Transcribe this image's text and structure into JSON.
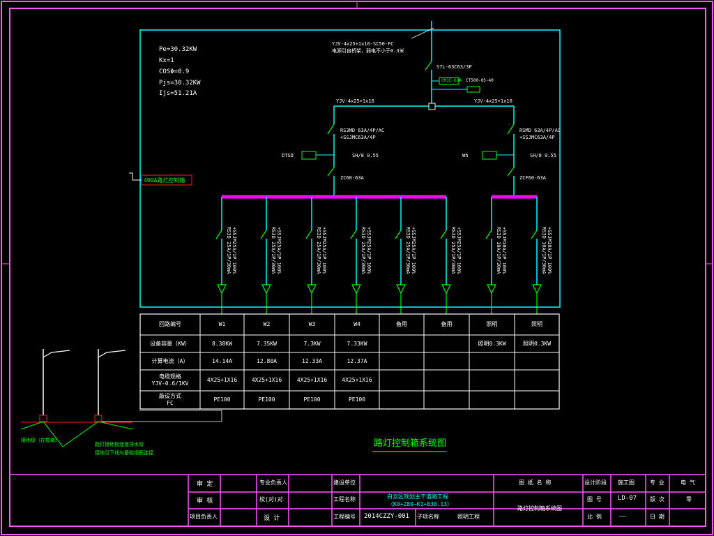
{
  "colors": {
    "frame": "#ff55ff",
    "wire": "#00ffff",
    "device": "#00ff00",
    "busbar": "#ff00ff",
    "table": "#ffffff",
    "red": "#ff2020",
    "title_green": "#00ff00"
  },
  "load_params": {
    "pe": "Pe=30.32KW",
    "kx": "Kx=1",
    "cos": "COSΦ=0.9",
    "pjs": "Pjs=30.32KW",
    "ijs": "Ijs=51.21A"
  },
  "incoming_cable": [
    "YJV-4x25+1x16-SC50-FC",
    "电源引自桥架，弱电不小于0.3米"
  ],
  "main_switch": "S7L-63C63/3P",
  "meter_left": "CM1E-63A",
  "meter_right": "CT500-05-40",
  "branch_cable_left": "YJV-4x25+1x16",
  "branch_cable_right": "YJV-4x25+1x16",
  "left_breaker": [
    "RS3MD 63A/4P/AC",
    "+SSJMC63A/4P"
  ],
  "right_breaker": [
    "RSMD 63A/4P/AC",
    "+SSJMC63A/4P"
  ],
  "left_controller": "DTSD",
  "right_controller": "Wh",
  "left_timer": "ZC60-63A",
  "right_timer": "ZCF60-63A",
  "left_value": "SH/8 0.55",
  "right_value": "SH/8 0.55",
  "red_label": "400A路灯控制箱",
  "feeder_labels": [
    [
      "RS3D 25A/1P/30mA",
      "+SSJM25A/1P 100%"
    ],
    [
      "RS3D 25A/1P/30mA",
      "+SSJM25A/1P 100%"
    ],
    [
      "RS3D 25A/1P/30mA",
      "+SSJM25A/1P 100%"
    ],
    [
      "RS3D 25A/1P/30mA",
      "+SSJM25A/1P 100%"
    ],
    [
      "RS3D 25A/1P/30mA",
      "+SSJM25A/1P 100%"
    ],
    [
      "RS3D 25A/1P/30mA",
      "+SSJM25A/1P 100%"
    ],
    [
      "RS3D 10A/1P/30mA",
      "+SSJM10A/1P 100%"
    ],
    [
      "RS3D 10A/1P/30mA",
      "+SSJM10A/1P 100%"
    ]
  ],
  "table": {
    "row_headers": [
      "回路编号",
      "设备容量（KW）",
      "计算电流（A）",
      "电缆规格\nYJV-0.6/1KV",
      "敲设方式\nFC"
    ],
    "columns": [
      [
        "W1",
        "8.38KW",
        "14.14A",
        "4X25+1X16",
        "PE100"
      ],
      [
        "W2",
        "7.35KW",
        "12.80A",
        "4X25+1X16",
        "PE100"
      ],
      [
        "W3",
        "7.3KW",
        "12.33A",
        "4X25+1X16",
        "PE100"
      ],
      [
        "W4",
        "7.33KW",
        "12.37A",
        "4X25+1X16",
        "PE100"
      ],
      [
        "备用",
        "",
        "",
        "",
        ""
      ],
      [
        "备用",
        "",
        "",
        "",
        ""
      ],
      [
        "照明",
        "照明0.3KW",
        "",
        "",
        ""
      ],
      [
        "照明",
        "照明0.3KW",
        "",
        "",
        ""
      ]
    ]
  },
  "drawing_title": "路灯控制箱系统图",
  "pole_notes": [
    "接地极（在框箱）",
    "路灯接地极连接排水管",
    "接地引下线与基础钢筋连接"
  ],
  "title_block": {
    "approve": "审 定",
    "review": "审 核",
    "project_lead": "项目负责人",
    "discipline_lead": "专业负责人",
    "check": "校(对)对",
    "design": "设  计",
    "client_label": "建设单位",
    "project_label": "工程名称",
    "project_name": "白云区规划主干道路工程",
    "project_range": "（K0+280~K1+830.13）",
    "number_label": "工程编号",
    "number": "2014CZZY-001",
    "sub_label": "子项名称",
    "sub_name": "照明工程",
    "drawing_name_label": "图 纸 名 称",
    "drawing_name": "路灯控制箱系统图",
    "stage_label": "设计阶段",
    "stage": "施工图",
    "discipline_label": "专 业",
    "discipline": "电 气",
    "fig_label": "图 号",
    "fig": "LD-07",
    "version_label": "版 次",
    "version": "零",
    "scale_label": "比 例",
    "scale": "——",
    "date_label": "日 期"
  }
}
